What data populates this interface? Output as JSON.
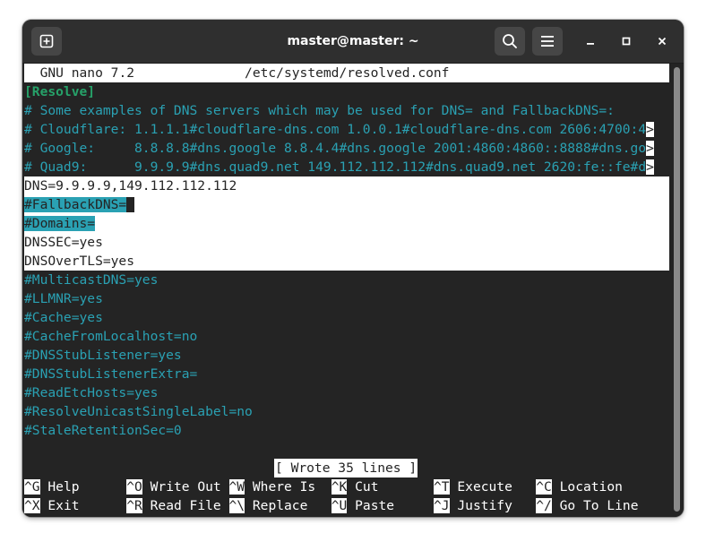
{
  "window": {
    "title": "master@master: ~"
  },
  "nano": {
    "version": "GNU nano 7.2",
    "filename": "/etc/systemd/resolved.conf",
    "section": "[Resolve]",
    "comment_lines": [
      "# Some examples of DNS servers which may be used for DNS= and FallbackDNS=:",
      "# Cloudflare: 1.1.1.1#cloudflare-dns.com 1.0.0.1#cloudflare-dns.com 2606:4700:4",
      "# Google:     8.8.8.8#dns.google 8.8.4.4#dns.google 2001:4860:4860::8888#dns.go",
      "# Quad9:      9.9.9.9#dns.quad9.net 149.112.112.112#dns.quad9.net 2620:fe::fe#d"
    ],
    "overflow_marker": ">",
    "dns_line": "DNS=9.9.9.9,149.112.112.112",
    "fallback_line": "#FallbackDNS=",
    "domains_line": "#Domains=",
    "dnssec_line": "DNSSEC=yes",
    "dnsovertls_line": "DNSOverTLS=yes",
    "rest_lines": [
      "#MulticastDNS=yes",
      "#LLMNR=yes",
      "#Cache=yes",
      "#CacheFromLocalhost=no",
      "#DNSStubListener=yes",
      "#DNSStubListenerExtra=",
      "#ReadEtcHosts=yes",
      "#ResolveUnicastSingleLabel=no",
      "#StaleRetentionSec=0"
    ],
    "status_message": "[ Wrote 35 lines ]",
    "shortcuts_row1": [
      {
        "key": "^G",
        "label": "Help"
      },
      {
        "key": "^O",
        "label": "Write Out"
      },
      {
        "key": "^W",
        "label": "Where Is"
      },
      {
        "key": "^K",
        "label": "Cut"
      },
      {
        "key": "^T",
        "label": "Execute"
      },
      {
        "key": "^C",
        "label": "Location"
      }
    ],
    "shortcuts_row2": [
      {
        "key": "^X",
        "label": "Exit"
      },
      {
        "key": "^R",
        "label": "Read File"
      },
      {
        "key": "^\\",
        "label": "Replace"
      },
      {
        "key": "^U",
        "label": "Paste"
      },
      {
        "key": "^J",
        "label": "Justify"
      },
      {
        "key": "^/",
        "label": "Go To Line"
      }
    ]
  },
  "icons": {
    "new_tab": "new-tab-icon",
    "search": "search-icon",
    "menu": "hamburger-menu-icon",
    "minimize": "minimize-icon",
    "maximize": "maximize-icon",
    "close": "close-icon"
  },
  "colors": {
    "terminal_bg": "#242424",
    "titlebar_bg": "#2f2f2f",
    "cyan": "#2aa1b3",
    "green": "#26a269",
    "white": "#ffffff"
  }
}
